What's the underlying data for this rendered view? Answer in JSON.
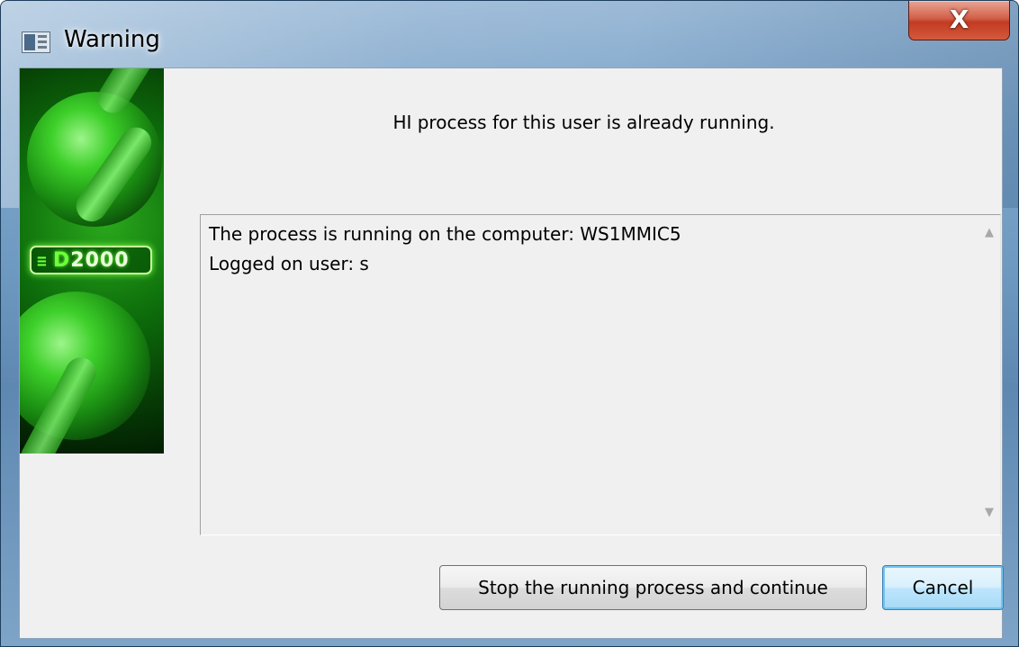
{
  "window": {
    "title": "Warning",
    "close_label": "X"
  },
  "banner": {
    "logo_mark": "≡",
    "logo_prefix": "D",
    "logo_suffix": "2000"
  },
  "message": "HI process for this user is already running.",
  "details": {
    "line1": "The process is running on the computer: WS1MMIC5",
    "line2": "Logged on user: s"
  },
  "buttons": {
    "stop_label": "Stop the running process and continue",
    "cancel_label": "Cancel"
  },
  "colors": {
    "accent_close": "#c23b22",
    "banner_green": "#1a8c12",
    "focus_blue": "#3c7fb1"
  }
}
